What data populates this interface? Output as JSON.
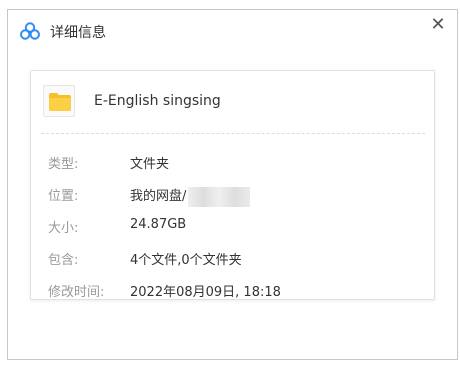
{
  "window": {
    "title": "详细信息",
    "close_glyph": "✕"
  },
  "file": {
    "name": "E-English singsing",
    "icon": "folder-icon"
  },
  "details": {
    "type_label": "类型:",
    "type_value": "文件夹",
    "location_label": "位置:",
    "location_value": "我的网盘/",
    "size_label": "大小:",
    "size_value": "24.87GB",
    "contains_label": "包含:",
    "contains_value": "4个文件,0个文件夹",
    "modified_label": "修改时间:",
    "modified_value": "2022年08月09日, 18:18"
  },
  "colors": {
    "folder": "#f7c02a",
    "brand_blue": "#2f8df5"
  }
}
